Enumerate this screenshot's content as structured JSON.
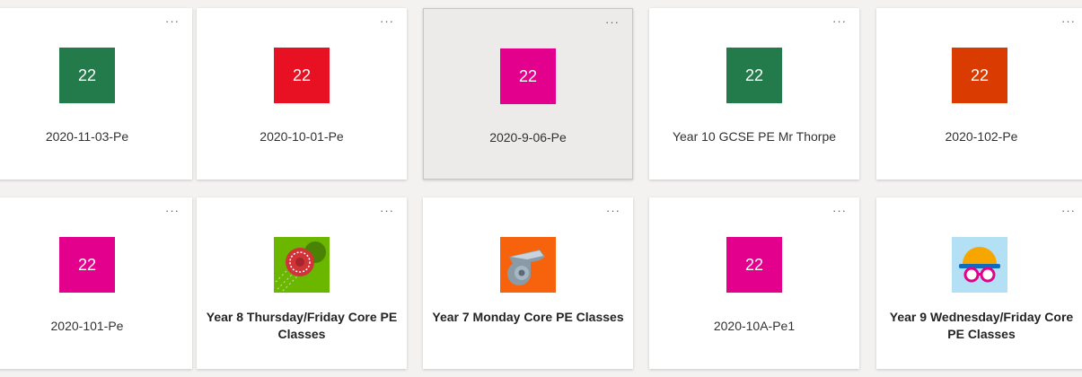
{
  "more_glyph": "···",
  "colors": {
    "green": "#237b4b",
    "red": "#e81123",
    "magenta": "#e3008c",
    "orange_red": "#da3b01",
    "cricket_bg": "#6bb700",
    "whistle_bg": "#f7630c",
    "swim_bg": "#b4e0f5"
  },
  "teams": [
    {
      "tile_text": "22",
      "name": "2020-11-03-Pe"
    },
    {
      "tile_text": "22",
      "name": "2020-10-01-Pe"
    },
    {
      "tile_text": "22",
      "name": "2020-9-06-Pe"
    },
    {
      "tile_text": "22",
      "name": "Year 10 GCSE PE Mr Thorpe"
    },
    {
      "tile_text": "22",
      "name": "2020-102-Pe"
    },
    {
      "tile_text": "22",
      "name": "2020-101-Pe"
    },
    {
      "icon": "cricket-ball-icon",
      "name": "Year 8 Thursday/Friday Core PE Classes"
    },
    {
      "icon": "whistle-icon",
      "name": "Year 7 Monday Core PE Classes"
    },
    {
      "tile_text": "22",
      "name": "2020-10A-Pe1"
    },
    {
      "icon": "swim-goggles-icon",
      "name": "Year 9 Wednesday/Friday Core PE Classes"
    }
  ]
}
